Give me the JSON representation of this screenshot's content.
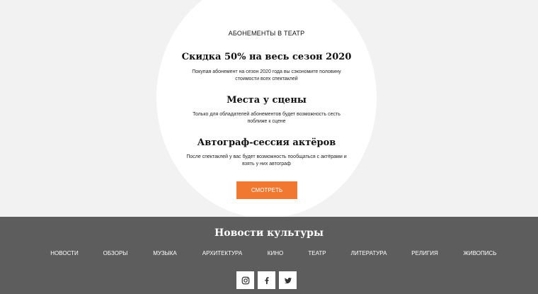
{
  "promo": {
    "eyebrow": "АБОНЕМЕНТЫ В ТЕАТР",
    "features": [
      {
        "title": "Скидка 50% на весь сезон 2020",
        "description": "Покупая абонемент на сезон 2020 года вы сэкономите половину стоимости всех спектаклей"
      },
      {
        "title": "Места у сцены",
        "description": "Только для обладателей абонементов будет возможность сесть поближе к сцене"
      },
      {
        "title": "Автограф-сессия актёров",
        "description": "После спектаклей у вас будет возможность пообщаться с актёрами и взять у них автограф"
      }
    ],
    "cta_label": "СМОТРЕТЬ"
  },
  "footer": {
    "title": "Новости культуры",
    "nav": [
      "НОВОСТИ",
      "ОБЗОРЫ",
      "МУЗЫКА",
      "АРХИТЕКТУРА",
      "КИНО",
      "ТЕАТР",
      "ЛИТЕРАТУРА",
      "РЕЛИГИЯ",
      "ЖИВОПИСЬ"
    ],
    "social": [
      "instagram-icon",
      "facebook-icon",
      "twitter-icon"
    ]
  },
  "colors": {
    "background": "#f2f2f2",
    "accent": "#f07830",
    "footer": "#5d5d5d"
  }
}
